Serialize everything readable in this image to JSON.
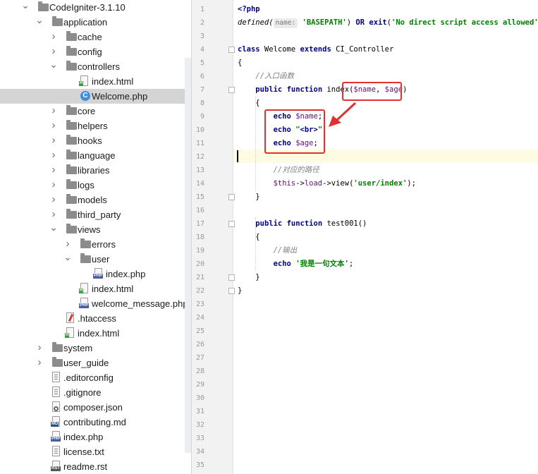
{
  "tree": {
    "items": [
      {
        "label": "CodeIgniter-3.1.10",
        "depth": 0,
        "kind": "folder",
        "state": "open"
      },
      {
        "label": "application",
        "depth": 1,
        "kind": "folder",
        "state": "open"
      },
      {
        "label": "cache",
        "depth": 2,
        "kind": "folder",
        "state": "closed"
      },
      {
        "label": "config",
        "depth": 2,
        "kind": "folder",
        "state": "closed"
      },
      {
        "label": "controllers",
        "depth": 2,
        "kind": "folder",
        "state": "open"
      },
      {
        "label": "index.html",
        "depth": 3,
        "kind": "html"
      },
      {
        "label": "Welcome.php",
        "depth": 3,
        "kind": "class",
        "selected": true
      },
      {
        "label": "core",
        "depth": 2,
        "kind": "folder",
        "state": "closed"
      },
      {
        "label": "helpers",
        "depth": 2,
        "kind": "folder",
        "state": "closed"
      },
      {
        "label": "hooks",
        "depth": 2,
        "kind": "folder",
        "state": "closed"
      },
      {
        "label": "language",
        "depth": 2,
        "kind": "folder",
        "state": "closed"
      },
      {
        "label": "libraries",
        "depth": 2,
        "kind": "folder",
        "state": "closed"
      },
      {
        "label": "logs",
        "depth": 2,
        "kind": "folder",
        "state": "closed"
      },
      {
        "label": "models",
        "depth": 2,
        "kind": "folder",
        "state": "closed"
      },
      {
        "label": "third_party",
        "depth": 2,
        "kind": "folder",
        "state": "closed"
      },
      {
        "label": "views",
        "depth": 2,
        "kind": "folder",
        "state": "open"
      },
      {
        "label": "errors",
        "depth": 3,
        "kind": "folder",
        "state": "closed"
      },
      {
        "label": "user",
        "depth": 3,
        "kind": "folder",
        "state": "open"
      },
      {
        "label": "index.php",
        "depth": 4,
        "kind": "php"
      },
      {
        "label": "index.html",
        "depth": 3,
        "kind": "html"
      },
      {
        "label": "welcome_message.php",
        "depth": 3,
        "kind": "php"
      },
      {
        "label": ".htaccess",
        "depth": 2,
        "kind": "htaccess"
      },
      {
        "label": "index.html",
        "depth": 2,
        "kind": "html"
      },
      {
        "label": "system",
        "depth": 1,
        "kind": "folder",
        "state": "closed"
      },
      {
        "label": "user_guide",
        "depth": 1,
        "kind": "folder",
        "state": "closed"
      },
      {
        "label": ".editorconfig",
        "depth": 1,
        "kind": "text"
      },
      {
        "label": ".gitignore",
        "depth": 1,
        "kind": "text"
      },
      {
        "label": "composer.json",
        "depth": 1,
        "kind": "json"
      },
      {
        "label": "contributing.md",
        "depth": 1,
        "kind": "md"
      },
      {
        "label": "index.php",
        "depth": 1,
        "kind": "php"
      },
      {
        "label": "license.txt",
        "depth": 1,
        "kind": "text"
      },
      {
        "label": "readme.rst",
        "depth": 1,
        "kind": "rst"
      }
    ]
  },
  "icon_tags": {
    "html": "H",
    "php": "PHP",
    "md": "MD",
    "rst": "RST",
    "class": "C"
  },
  "editor": {
    "line_count": 35,
    "current_line": 12,
    "lines": [
      [
        {
          "t": "<?php",
          "c": "tg"
        }
      ],
      [
        {
          "t": "defined(",
          "c": "fn"
        },
        {
          "t": "name:",
          "c": "hint"
        },
        {
          "t": " "
        },
        {
          "t": "'BASEPATH'",
          "c": "st"
        },
        {
          "t": ") "
        },
        {
          "t": "OR",
          "c": "kw"
        },
        {
          "t": " "
        },
        {
          "t": "exit",
          "c": "kw"
        },
        {
          "t": "("
        },
        {
          "t": "'No direct script access allowed'",
          "c": "st"
        },
        {
          "t": ");"
        }
      ],
      [],
      [
        {
          "t": "class",
          "c": "kw"
        },
        {
          "t": " Welcome "
        },
        {
          "t": "extends",
          "c": "kw"
        },
        {
          "t": " CI_Controller"
        }
      ],
      [
        {
          "t": "{"
        }
      ],
      [
        {
          "t": "    "
        },
        {
          "t": "//入口函数",
          "c": "cm"
        }
      ],
      [
        {
          "t": "    "
        },
        {
          "t": "public",
          "c": "kw"
        },
        {
          "t": " "
        },
        {
          "t": "function",
          "c": "kw"
        },
        {
          "t": " index("
        },
        {
          "t": "$name",
          "c": "vr"
        },
        {
          "t": ", "
        },
        {
          "t": "$age",
          "c": "vr"
        },
        {
          "t": ")"
        }
      ],
      [
        {
          "t": "    {"
        }
      ],
      [
        {
          "t": "        "
        },
        {
          "t": "echo",
          "c": "kw"
        },
        {
          "t": " "
        },
        {
          "t": "$name",
          "c": "vr"
        },
        {
          "t": ";"
        }
      ],
      [
        {
          "t": "        "
        },
        {
          "t": "echo",
          "c": "kw"
        },
        {
          "t": " "
        },
        {
          "t": "\"",
          "c": "st"
        },
        {
          "t": "<br>",
          "c": "tg"
        },
        {
          "t": "\"",
          "c": "st"
        },
        {
          "t": ";"
        }
      ],
      [
        {
          "t": "        "
        },
        {
          "t": "echo",
          "c": "kw"
        },
        {
          "t": " "
        },
        {
          "t": "$age",
          "c": "vr"
        },
        {
          "t": ";"
        }
      ],
      [],
      [
        {
          "t": "        "
        },
        {
          "t": "//对应的路径",
          "c": "cm"
        }
      ],
      [
        {
          "t": "        "
        },
        {
          "t": "$this",
          "c": "vr"
        },
        {
          "t": "->"
        },
        {
          "t": "load",
          "c": "vr"
        },
        {
          "t": "->view("
        },
        {
          "t": "'user/index'",
          "c": "st"
        },
        {
          "t": ");"
        }
      ],
      [
        {
          "t": "    }"
        }
      ],
      [],
      [
        {
          "t": "    "
        },
        {
          "t": "public",
          "c": "kw"
        },
        {
          "t": " "
        },
        {
          "t": "function",
          "c": "kw"
        },
        {
          "t": " test001()"
        }
      ],
      [
        {
          "t": "    {"
        }
      ],
      [
        {
          "t": "        "
        },
        {
          "t": "//输出",
          "c": "cm"
        }
      ],
      [
        {
          "t": "        "
        },
        {
          "t": "echo",
          "c": "kw"
        },
        {
          "t": " "
        },
        {
          "t": "'我是一句文本'",
          "c": "st"
        },
        {
          "t": ";"
        }
      ],
      [
        {
          "t": "    }"
        }
      ],
      [
        {
          "t": "}"
        }
      ]
    ]
  },
  "colors": {
    "annotation": "#e03030",
    "selection": "#d4d4d4",
    "current_line": "#fdfce2"
  }
}
